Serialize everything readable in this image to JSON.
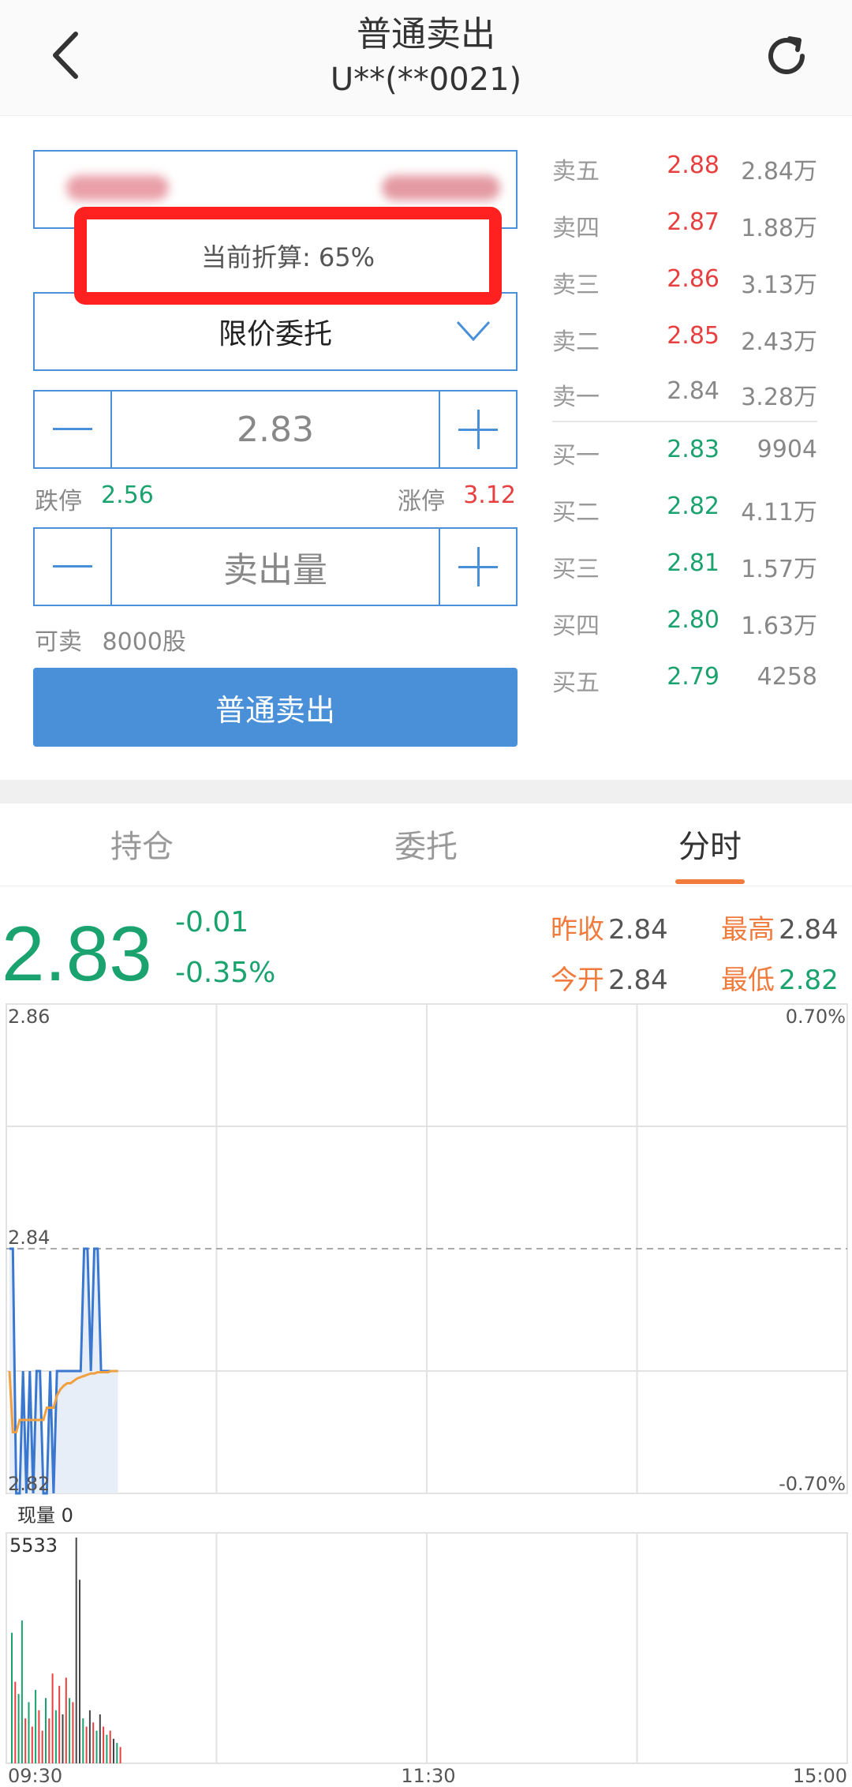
{
  "header": {
    "title": "普通卖出",
    "subtitle": "U**(**0021)",
    "back_icon": "chevron-left-icon",
    "refresh_icon": "refresh-icon"
  },
  "form": {
    "discount_text": "当前折算: 65%",
    "order_type": "限价委托",
    "price_value": "2.83",
    "limit_down_label": "跌停",
    "limit_down_value": "2.56",
    "limit_up_label": "涨停",
    "limit_up_value": "3.12",
    "quantity_placeholder": "卖出量",
    "available_label": "可卖",
    "available_value": "8000股",
    "submit_label": "普通卖出"
  },
  "order_book": {
    "asks": [
      {
        "label": "卖五",
        "price": "2.88",
        "volume": "2.84万",
        "price_color": "#e84040"
      },
      {
        "label": "卖四",
        "price": "2.87",
        "volume": "1.88万",
        "price_color": "#e84040"
      },
      {
        "label": "卖三",
        "price": "2.86",
        "volume": "3.13万",
        "price_color": "#e84040"
      },
      {
        "label": "卖二",
        "price": "2.85",
        "volume": "2.43万",
        "price_color": "#e84040"
      },
      {
        "label": "卖一",
        "price": "2.84",
        "volume": "3.28万",
        "price_color": "#888888"
      }
    ],
    "bids": [
      {
        "label": "买一",
        "price": "2.83",
        "volume": "9904",
        "price_color": "#1aa36e"
      },
      {
        "label": "买二",
        "price": "2.82",
        "volume": "4.11万",
        "price_color": "#1aa36e"
      },
      {
        "label": "买三",
        "price": "2.81",
        "volume": "1.57万",
        "price_color": "#1aa36e"
      },
      {
        "label": "买四",
        "price": "2.80",
        "volume": "1.63万",
        "price_color": "#1aa36e"
      },
      {
        "label": "买五",
        "price": "2.79",
        "volume": "4258",
        "price_color": "#1aa36e"
      }
    ]
  },
  "tabs": [
    {
      "label": "持仓",
      "active": false
    },
    {
      "label": "委托",
      "active": false
    },
    {
      "label": "分时",
      "active": true
    }
  ],
  "quote": {
    "last": "2.83",
    "change": "-0.01",
    "change_pct": "-0.35%",
    "prev_close_label": "昨收",
    "prev_close": "2.84",
    "open_label": "今开",
    "open": "2.84",
    "high_label": "最高",
    "high": "2.84",
    "low_label": "最低",
    "low": "2.82"
  },
  "chart_data": {
    "type": "line",
    "y_tick_labels": [
      "2.86",
      "2.84",
      "2.82"
    ],
    "right_tick_labels": [
      "0.70%",
      "-0.70%"
    ],
    "x_tick_labels": [
      "09:30",
      "11:30",
      "15:00"
    ],
    "ylim": [
      2.82,
      2.86
    ],
    "prev_close": 2.84,
    "series": [
      {
        "color": "#3a78d0",
        "values": [
          2.84,
          2.84,
          2.82,
          2.82,
          2.83,
          2.82,
          2.83,
          2.82,
          2.83,
          2.83,
          2.82,
          2.82,
          2.83,
          2.82,
          2.83,
          2.83,
          2.83,
          2.83,
          2.83,
          2.83,
          2.83,
          2.83,
          2.84,
          2.84,
          2.83,
          2.84,
          2.84,
          2.83,
          2.83,
          2.83,
          2.83,
          2.83,
          2.83
        ]
      },
      {
        "color": "#f0a040",
        "values": [
          2.83,
          2.825,
          2.825,
          2.826,
          2.826,
          2.826,
          2.826,
          2.826,
          2.826,
          2.826,
          2.826,
          2.827,
          2.827,
          2.827,
          2.828,
          2.8285,
          2.8288,
          2.829,
          2.829,
          2.8292,
          2.8294,
          2.8295,
          2.8296,
          2.8297,
          2.8298,
          2.8298,
          2.8299,
          2.8299,
          2.8299,
          2.8299,
          2.83,
          2.83,
          2.83
        ]
      },
      {
        "color": "#e8eef8",
        "values": []
      }
    ],
    "volume": {
      "label": "现量 0",
      "max_label": "5533",
      "max": 5533,
      "values": [
        3200,
        2000,
        1700,
        3500,
        1100,
        1500,
        900,
        1800,
        1300,
        800,
        1600,
        1100,
        2200,
        1300,
        1900,
        1200,
        2100,
        1600,
        1500,
        5533,
        4500,
        1100,
        900,
        1300,
        1000,
        800,
        1200,
        900,
        700,
        800,
        600,
        500,
        400
      ],
      "colors": [
        "g",
        "r",
        "g",
        "g",
        "r",
        "g",
        "r",
        "g",
        "r",
        "r",
        "g",
        "r",
        "r",
        "g",
        "r",
        "k",
        "r",
        "g",
        "r",
        "k",
        "k",
        "g",
        "r",
        "k",
        "r",
        "g",
        "k",
        "r",
        "g",
        "r",
        "k",
        "g",
        "r"
      ]
    }
  }
}
